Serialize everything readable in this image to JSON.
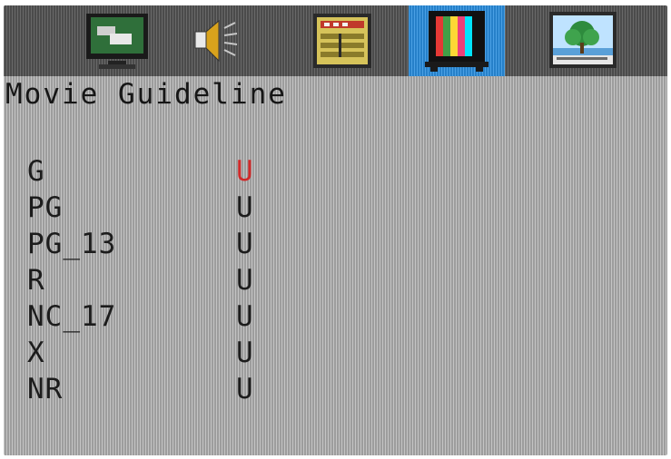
{
  "menu": {
    "tabs": [
      {
        "name": "picture",
        "icon": "monitor-icon",
        "selected": false
      },
      {
        "name": "sound",
        "icon": "speaker-icon",
        "selected": false
      },
      {
        "name": "setup",
        "icon": "menu-panel-icon",
        "selected": false
      },
      {
        "name": "parental-lock",
        "icon": "tv-color-bars-icon",
        "selected": true
      },
      {
        "name": "photo",
        "icon": "landscape-picture-icon",
        "selected": false
      }
    ]
  },
  "page": {
    "title": "Movie Guideline"
  },
  "ratings": [
    {
      "label": "G",
      "state": "U",
      "active": true
    },
    {
      "label": "PG",
      "state": "U",
      "active": false
    },
    {
      "label": "PG_13",
      "state": "U",
      "active": false
    },
    {
      "label": "R",
      "state": "U",
      "active": false
    },
    {
      "label": "NC_17",
      "state": "U",
      "active": false
    },
    {
      "label": "X",
      "state": "U",
      "active": false
    },
    {
      "label": "NR",
      "state": "U",
      "active": false
    }
  ],
  "colors": {
    "screen_bg": "#b3b3b3",
    "menu_bar": "#585858",
    "selected_tab": "#2a8fe0",
    "text": "#1c1c1c",
    "highlight": "#d02a2a"
  }
}
